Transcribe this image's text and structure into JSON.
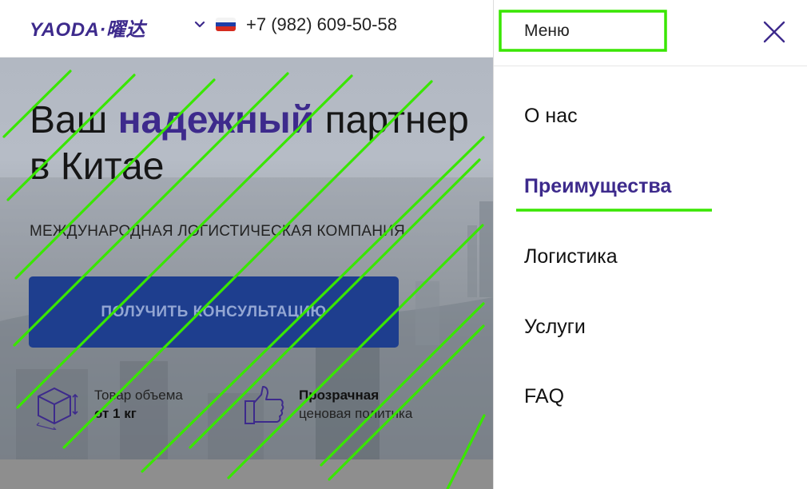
{
  "header": {
    "logo": "YAODA·曜达",
    "phone": "+7 (982) 609-50-58",
    "flag_colors": [
      "#ffffff",
      "#1c3ea8",
      "#d52b1e"
    ]
  },
  "hero": {
    "title_part1": "Ваш ",
    "title_accent": "надежный",
    "title_part2": " партнер",
    "title_line2": "в Китае",
    "subtitle": "МЕЖДУНАРОДНАЯ ЛОГИСТИЧЕСКАЯ КОМПАНИЯ",
    "cta_label": "ПОЛУЧИТЬ КОНСУЛЬТАЦИЮ",
    "features": [
      {
        "line1": "Товар объема",
        "line2": "от 1 кг",
        "icon": "box-icon"
      },
      {
        "line1": "Прозрачная",
        "line2": "ценовая политика",
        "icon": "thumbs-up-icon"
      }
    ]
  },
  "menu": {
    "title": "Меню",
    "items": [
      {
        "label": "О нас"
      },
      {
        "label": "Преимущества",
        "active": true
      },
      {
        "label": "Логистика"
      },
      {
        "label": "Услуги"
      },
      {
        "label": "FAQ"
      }
    ]
  },
  "colors": {
    "brand": "#3d2a8c",
    "cta": "#1e3e8e",
    "annotation": "#39e600"
  }
}
